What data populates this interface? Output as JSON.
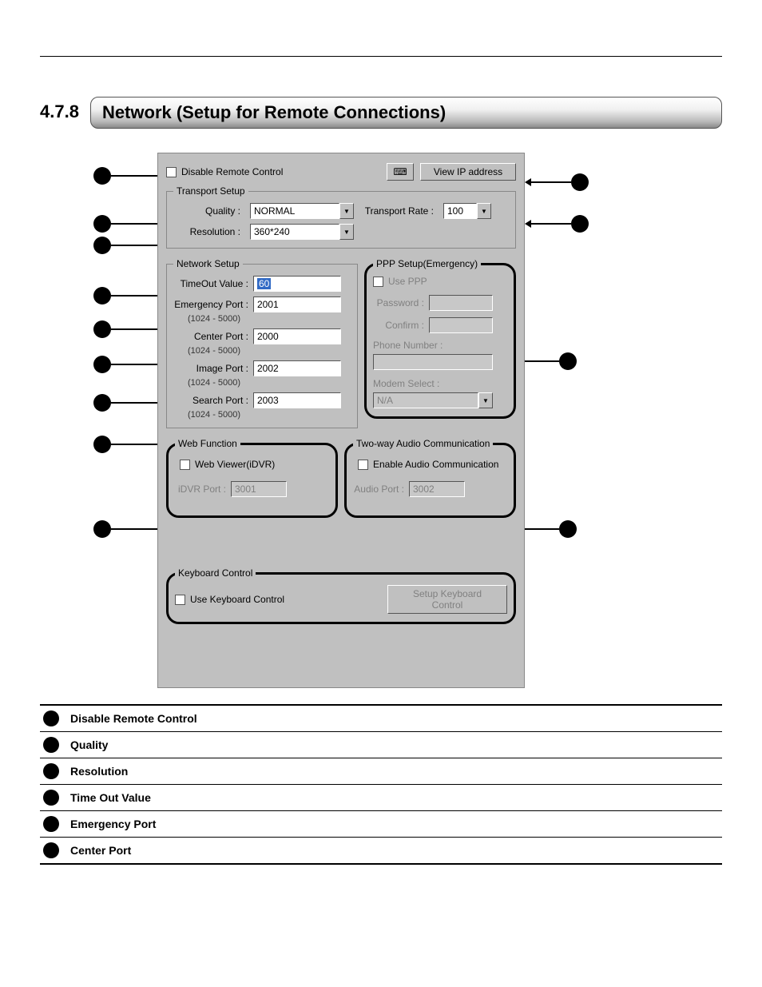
{
  "section": {
    "number": "4.7.8",
    "title": "Network (Setup for Remote Connections)"
  },
  "dialog": {
    "disable_remote": "Disable Remote Control",
    "view_ip": "View  IP address",
    "transport": {
      "legend": "Transport Setup",
      "quality_label": "Quality :",
      "quality_value": "NORMAL",
      "resolution_label": "Resolution :",
      "resolution_value": "360*240",
      "rate_label": "Transport Rate :",
      "rate_value": "100"
    },
    "network": {
      "legend": "Network Setup",
      "timeout_label": "TimeOut Value :",
      "timeout_value": "60",
      "emergency_label": "Emergency Port :",
      "emergency_value": "2001",
      "center_label": "Center Port :",
      "center_value": "2000",
      "image_label": "Image Port :",
      "image_value": "2002",
      "search_label": "Search Port :",
      "search_value": "2003",
      "range": "(1024 - 5000)"
    },
    "ppp": {
      "legend": "PPP Setup(Emergency)",
      "use_ppp": "Use PPP",
      "password_label": "Password :",
      "confirm_label": "Confirm :",
      "phone_label": "Phone Number :",
      "modem_label": "Modem Select :",
      "modem_value": "N/A"
    },
    "web": {
      "legend": "Web Function",
      "viewer": "Web Viewer(iDVR)",
      "port_label": "iDVR Port :",
      "port_value": "3001"
    },
    "audio": {
      "legend": "Two-way Audio Communication",
      "enable": "Enable Audio Communication",
      "port_label": "Audio Port :",
      "port_value": "3002"
    },
    "keyboard": {
      "legend": "Keyboard Control",
      "use": "Use Keyboard Control",
      "button": "Setup Keyboard Control"
    }
  },
  "legend_list": [
    "Disable Remote Control",
    "Quality",
    "Resolution",
    "Time Out Value",
    "Emergency Port",
    "Center Port"
  ]
}
